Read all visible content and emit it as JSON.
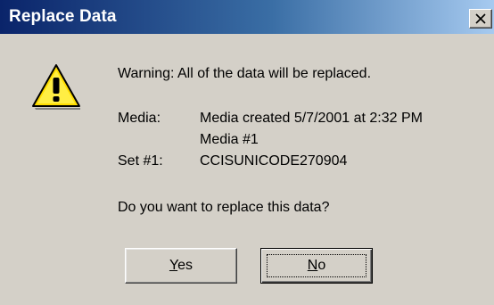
{
  "window": {
    "title": "Replace Data",
    "close_icon": "close-icon"
  },
  "icon": "warning-icon",
  "message": {
    "warning": "Warning: All of the data will be replaced.",
    "media_label": "Media:",
    "media_value_line1": "Media created 5/7/2001 at 2:32 PM",
    "media_value_line2": "Media #1",
    "set_label": "Set #1:",
    "set_value": "CCISUNICODE270904",
    "question": "Do you want to replace this data?"
  },
  "buttons": {
    "yes": {
      "mnemonic": "Y",
      "rest": "es"
    },
    "no": {
      "mnemonic": "N",
      "rest": "o"
    }
  },
  "colors": {
    "title_bar_start": "#0a246a",
    "title_bar_end": "#a6caf0",
    "dialog_bg": "#d4d0c8"
  }
}
